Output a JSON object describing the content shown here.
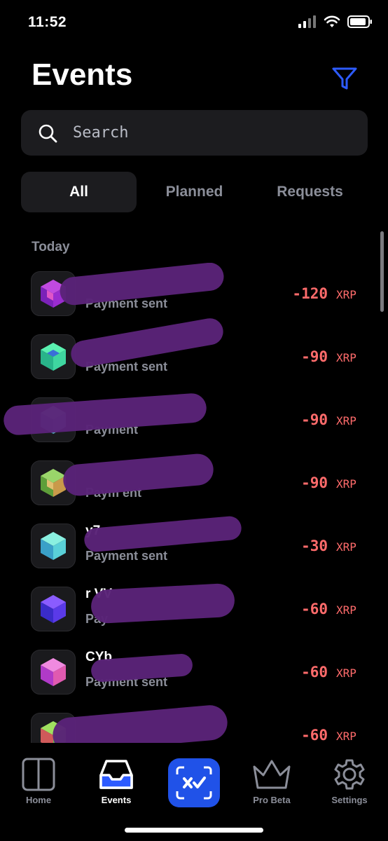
{
  "status_bar": {
    "time": "11:52"
  },
  "header": {
    "title": "Events"
  },
  "search": {
    "placeholder": "Search"
  },
  "tabs": [
    {
      "label": "All",
      "active": true
    },
    {
      "label": "Planned",
      "active": false
    },
    {
      "label": "Requests",
      "active": false
    }
  ],
  "sections": {
    "today": "Today"
  },
  "events": [
    {
      "title": "",
      "subtitle": "Payment sent",
      "amount": "-120",
      "currency": "XRP",
      "icon": "purple-cube-icon"
    },
    {
      "title": "",
      "subtitle": "Payment sent",
      "amount": "-90",
      "currency": "XRP",
      "icon": "green-cube-icon"
    },
    {
      "title": "",
      "subtitle": "Payment",
      "amount": "-90",
      "currency": "XRP",
      "icon": "teal-cube-icon"
    },
    {
      "title": "",
      "subtitle": "Paym       ent",
      "amount": "-90",
      "currency": "XRP",
      "icon": "olive-cube-icon"
    },
    {
      "title": "                y7",
      "subtitle": "Payment sent",
      "amount": "-30",
      "currency": "XRP",
      "icon": "cyan-cube-icon"
    },
    {
      "title": "r                VV",
      "subtitle": "Pay",
      "amount": "-60",
      "currency": "XRP",
      "icon": "indigo-cube-icon"
    },
    {
      "title": "                CYb",
      "subtitle": "Payment sent",
      "amount": "-60",
      "currency": "XRP",
      "icon": "pink-cube-icon"
    },
    {
      "title": "",
      "subtitle": "",
      "amount": "-60",
      "currency": "XRP",
      "icon": "lime-cube-icon"
    }
  ],
  "bottom_nav": {
    "home": "Home",
    "events": "Events",
    "pro": "Pro Beta",
    "settings": "Settings"
  },
  "colors": {
    "accent": "#2052e8",
    "negative_amount": "#ff6b6b",
    "redaction": "#5a2378"
  }
}
